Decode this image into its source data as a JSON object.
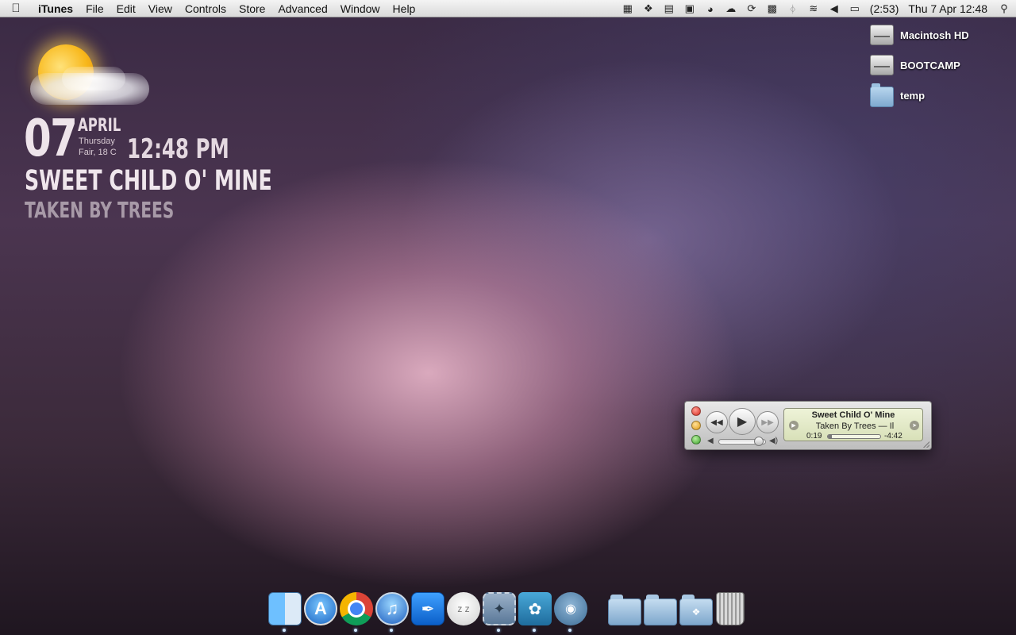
{
  "menubar": {
    "apple_icon": "apple-logo-icon",
    "app_name": "iTunes",
    "menus": [
      "File",
      "Edit",
      "View",
      "Controls",
      "Store",
      "Advanced",
      "Window",
      "Help"
    ],
    "status_icons": [
      "screen-capture-icon",
      "dropbox-icon",
      "document-icon",
      "notes-icon",
      "cup-icon",
      "cloud-icon",
      "sync-icon",
      "battery-bar-icon",
      "bluetooth-icon",
      "wifi-icon",
      "volume-icon",
      "battery-icon"
    ],
    "battery_time": "(2:53)",
    "datetime": "Thu 7 Apr  12:48",
    "spotlight_icon": "spotlight-search-icon"
  },
  "widget": {
    "day": "07",
    "month": "APRIL",
    "weekday": "Thursday",
    "weather": "Fair, 18 C",
    "time": "12:48 PM",
    "song": "SWEET CHILD O' MINE",
    "artist": "TAKEN BY TREES"
  },
  "desktop_icons": [
    {
      "label": "Macintosh HD",
      "icon": "hard-drive-icon"
    },
    {
      "label": "BOOTCAMP",
      "icon": "hard-drive-icon"
    },
    {
      "label": "temp",
      "icon": "folder-icon"
    }
  ],
  "mini_player": {
    "title": "Sweet Child O' Mine",
    "subtitle": "Taken By Trees — Il",
    "elapsed": "0:19",
    "remaining": "-4:42",
    "progress": 0.07,
    "volume": 0.85
  },
  "dock": {
    "apps": [
      "finder",
      "app-store",
      "chrome",
      "itunes",
      "pen-app",
      "chat",
      "mail-stamp",
      "twitter",
      "facetime"
    ],
    "running_indicators": [
      "finder",
      "itunes",
      "mail-stamp",
      "twitter",
      "facetime",
      "chrome"
    ]
  }
}
